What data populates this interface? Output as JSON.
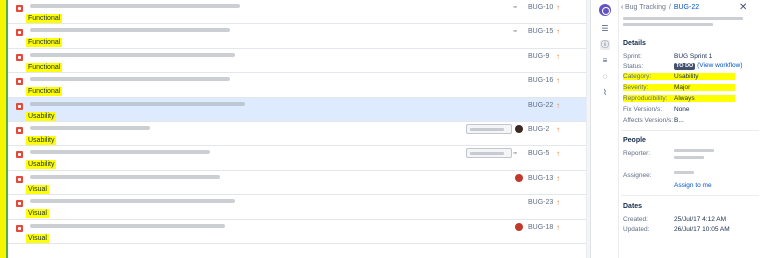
{
  "issues": [
    {
      "key": "BUG-10",
      "category": "Functional",
      "summary_w": 210,
      "marker": "glasses",
      "selected": false
    },
    {
      "key": "BUG-15",
      "category": "Functional",
      "summary_w": 200,
      "marker": "glasses",
      "selected": false
    },
    {
      "key": "BUG-9",
      "category": "Functional",
      "summary_w": 205,
      "marker": "none",
      "selected": false
    },
    {
      "key": "BUG-16",
      "category": "Functional",
      "summary_w": 200,
      "marker": "none",
      "selected": false
    },
    {
      "key": "BUG-22",
      "category": "Usability",
      "summary_w": 215,
      "marker": "none",
      "selected": true
    },
    {
      "key": "BUG-2",
      "category": "Usability",
      "summary_w": 120,
      "marker": "sprint-avatar-dark",
      "selected": false
    },
    {
      "key": "BUG-5",
      "category": "Usability",
      "summary_w": 180,
      "marker": "sprint-glasses",
      "selected": false
    },
    {
      "key": "BUG-13",
      "category": "Visual",
      "summary_w": 190,
      "marker": "avatar-red",
      "selected": false
    },
    {
      "key": "BUG-23",
      "category": "Visual",
      "summary_w": 205,
      "marker": "none",
      "selected": false
    },
    {
      "key": "BUG-18",
      "category": "Visual",
      "summary_w": 195,
      "marker": "avatar-red",
      "selected": false
    }
  ],
  "detail": {
    "breadcrumb_project": "Bug Tracking",
    "breadcrumb_sep": "/",
    "breadcrumb_key": "BUG-22",
    "details_title": "Details",
    "fields": {
      "sprint_label": "Sprint:",
      "sprint_value": "BUG Sprint 1",
      "status_label": "Status:",
      "status_value": "TO DO",
      "status_link": "(View workflow)",
      "category_label": "Category:",
      "category_value": "Usability",
      "severity_label": "Severity:",
      "severity_value": "Major",
      "reproducibility_label": "Reproducibility:",
      "reproducibility_value": "Always",
      "fix_label": "Fix Version/s:",
      "fix_value": "None",
      "affects_label": "Affects Version/s:",
      "affects_value": "B..."
    },
    "people_title": "People",
    "reporter_label": "Reporter:",
    "assignee_label": "Assignee:",
    "assign_to_me": "Assign to me",
    "dates_title": "Dates",
    "created_label": "Created:",
    "created_value": "25/Jul/17 4:12 AM",
    "updated_label": "Updated:",
    "updated_value": "26/Jul/17 10:05 AM"
  },
  "colors": {
    "highlight": "#ffff00",
    "bug_type": "#e5493a",
    "priority": "#e97f33",
    "link": "#0052cc",
    "selected_row": "#deebff"
  },
  "icons": [
    "bug-icon",
    "glasses-icon",
    "priority-arrow-icon",
    "info-icon",
    "comment-icon",
    "attachment-icon",
    "close-icon",
    "back-arrow-icon"
  ]
}
